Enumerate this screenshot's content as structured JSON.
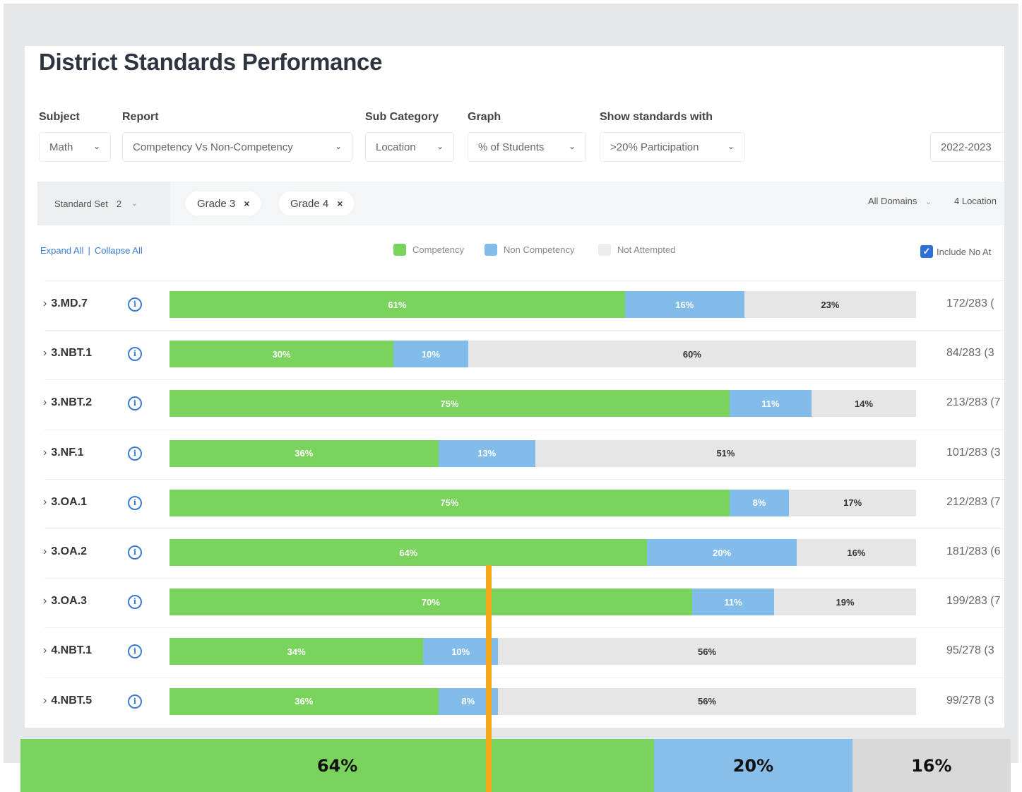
{
  "page": {
    "title": "District Standards Performance"
  },
  "filters": {
    "subject": {
      "label": "Subject",
      "value": "Math"
    },
    "report": {
      "label": "Report",
      "value": "Competency Vs Non-Competency"
    },
    "sub_category": {
      "label": "Sub Category",
      "value": "Location"
    },
    "graph": {
      "label": "Graph",
      "value": "% of Students"
    },
    "show_standards": {
      "label": "Show standards with",
      "value": ">20% Participation"
    },
    "year": {
      "value": "2022-2023"
    }
  },
  "filter_bar": {
    "standard_set_label": "Standard Set",
    "standard_set_count": "2",
    "chips": [
      "Grade 3",
      "Grade 4"
    ],
    "domains": "All Domains",
    "locations": "4 Location"
  },
  "controls": {
    "expand_all": "Expand All",
    "separator": "|",
    "collapse_all": "Collapse All",
    "include_label": "Include No At"
  },
  "chart_data": {
    "type": "bar",
    "stacked": true,
    "orientation": "horizontal",
    "categories": [
      "3.MD.7",
      "3.NBT.1",
      "3.NBT.2",
      "3.NF.1",
      "3.OA.1",
      "3.OA.2",
      "3.OA.3",
      "4.NBT.1",
      "4.NBT.5"
    ],
    "series": [
      {
        "name": "Competency",
        "color": "#7ad35c",
        "values": [
          61,
          30,
          75,
          36,
          75,
          64,
          70,
          34,
          36
        ]
      },
      {
        "name": "Non Competency",
        "color": "#82bcea",
        "values": [
          16,
          10,
          11,
          13,
          8,
          20,
          11,
          10,
          8
        ]
      },
      {
        "name": "Not Attempted",
        "color": "#e6e6e6",
        "values": [
          23,
          60,
          14,
          51,
          17,
          16,
          19,
          56,
          56
        ]
      }
    ],
    "counts": [
      "172/283 (",
      "84/283 (3",
      "213/283 (7",
      "101/283 (3",
      "212/283 (7",
      "181/283 (6",
      "199/283 (7",
      "95/278 (3",
      "99/278 (3"
    ],
    "legend_position": "top-center",
    "value_format": "%"
  },
  "zoom_bar": {
    "labels": [
      "64%",
      "20%",
      "16%"
    ],
    "values": [
      64,
      20,
      16
    ]
  },
  "colors": {
    "marker": "#f5a91a",
    "link": "#3a7bd5"
  }
}
